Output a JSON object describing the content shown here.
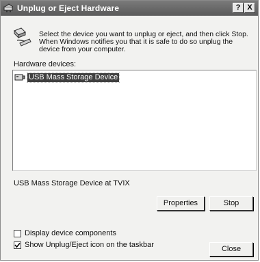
{
  "window": {
    "title": "Unplug or Eject Hardware",
    "help_label": "?",
    "close_label": "X"
  },
  "intro": {
    "text": "Select the device you want to unplug or eject, and then click Stop. When Windows notifies you that it is safe to do so unplug the device from your computer."
  },
  "devices": {
    "label": "Hardware devices:",
    "items": [
      {
        "label": "USB Mass Storage Device",
        "icon": "usb-device-icon",
        "selected": true
      }
    ],
    "selected_description": "USB Mass Storage Device at TVIX"
  },
  "buttons": {
    "properties": "Properties",
    "stop": "Stop",
    "close": "Close"
  },
  "options": {
    "display_components": {
      "label": "Display device components",
      "checked": false
    },
    "show_taskbar_icon": {
      "label": "Show Unplug/Eject icon on the taskbar",
      "checked": true
    }
  },
  "colors": {
    "titlebar": "#5a5a5a",
    "selection": "#404040",
    "window_bg": "#f2f2f0"
  }
}
